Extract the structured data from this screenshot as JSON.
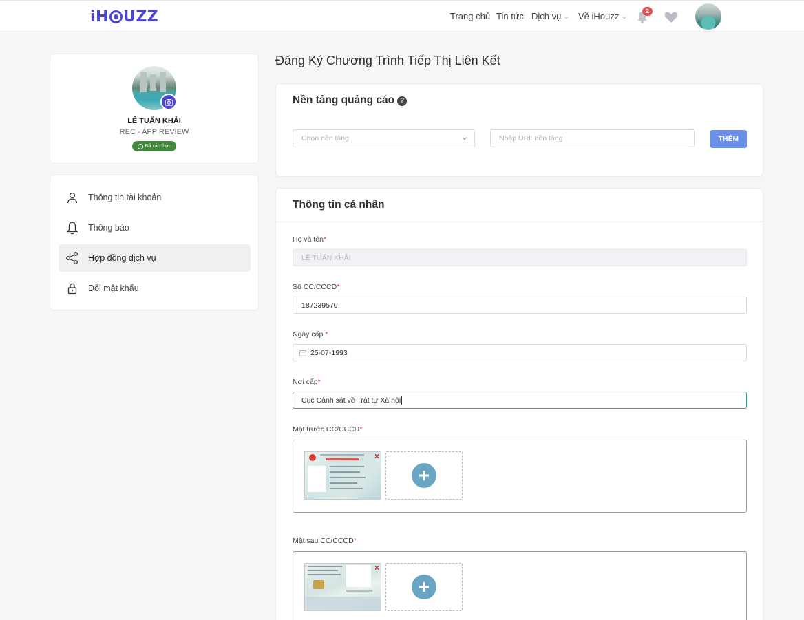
{
  "brand": {
    "logo_left": "iH",
    "logo_right": "UZZ"
  },
  "nav": {
    "home": "Trang chủ",
    "news": "Tin tức",
    "services": "Dịch vụ",
    "about": "Về iHouzz",
    "notification_count": "2"
  },
  "profile": {
    "name": "LÊ TUẤN KHẢI",
    "role": "REC - APP REVIEW",
    "verified": "Đã xác thực"
  },
  "menu": {
    "items": [
      {
        "label": "Thông tin tài khoản"
      },
      {
        "label": "Thông báo"
      },
      {
        "label": "Hợp đồng dịch vụ"
      },
      {
        "label": "Đổi mật khẩu"
      }
    ]
  },
  "page": {
    "title": "Đăng Ký Chương Trình Tiếp Thị Liên Kết"
  },
  "ads": {
    "title": "Nền tảng quảng cáo",
    "help": "?",
    "platform_placeholder": "Chọn nền tảng",
    "url_placeholder": "Nhập URL nền tảng",
    "add_label": "THÊM"
  },
  "personal": {
    "title": "Thông tin cá nhân",
    "fullname_label": "Họ và tên",
    "fullname_value": "LÊ TUẤN KHẢI",
    "id_label": "Số CC/CCCD",
    "id_value": "187239570",
    "issue_date_label": "Ngày cấp ",
    "issue_date_value": "25-07-1993",
    "issue_place_label": "Nơi cấp",
    "issue_place_value": "Cục Cảnh sát về Trật tự Xã hội",
    "front_label": "Mặt trước CC/CCCD",
    "back_label": "Mặt sau CC/CCCD",
    "required_mark": "*",
    "remove_mark": "×"
  },
  "colors": {
    "brand": "#4a45d6",
    "button": "#6b8ee8",
    "verified": "#3f8a3a",
    "badge": "#e35252",
    "plus": "#6aa6c4"
  }
}
